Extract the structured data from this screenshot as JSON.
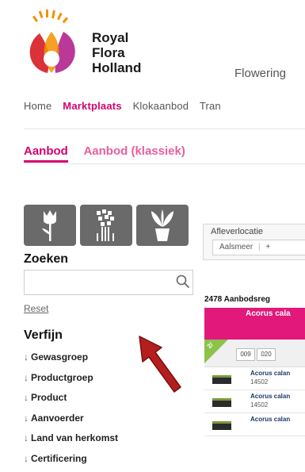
{
  "brand": {
    "name_lines": [
      "Royal",
      "Flora",
      "Holland"
    ],
    "header_title": "Flowering",
    "colors": {
      "accent": "#d6006e",
      "logo_red": "#d9262e",
      "logo_orange": "#f29100",
      "logo_purple": "#b3228c"
    }
  },
  "nav": {
    "items": [
      "Home",
      "Marktplaats",
      "Klokaanbod",
      "Tran"
    ],
    "active": "Marktplaats"
  },
  "tabs": {
    "items": [
      "Aanbod",
      "Aanbod (klassiek)"
    ],
    "active": "Aanbod"
  },
  "category_buttons": [
    {
      "icon": "tulip-icon"
    },
    {
      "icon": "bouquet-icon"
    },
    {
      "icon": "potted-plant-icon"
    }
  ],
  "search": {
    "heading": "Zoeken",
    "value": "",
    "reset_label": "Reset"
  },
  "refine": {
    "heading": "Verfijn",
    "filters": [
      "Gewasgroep",
      "Productgroep",
      "Product",
      "Aanvoerder",
      "Land van herkomst",
      "Certificering"
    ]
  },
  "location": {
    "label": "Afleverlocatie",
    "selected": "Aalsmeer",
    "extra": "+"
  },
  "results": {
    "count_text": "2478 Aanbodsreg",
    "header": "Acorus cala",
    "badge": "2/",
    "pages": [
      "009",
      "020"
    ],
    "rows": [
      {
        "name": "Acorus calan",
        "code": "14502"
      },
      {
        "name": "Acorus calan",
        "code": "14502"
      },
      {
        "name": "Acorus calan",
        "code": ""
      }
    ]
  }
}
